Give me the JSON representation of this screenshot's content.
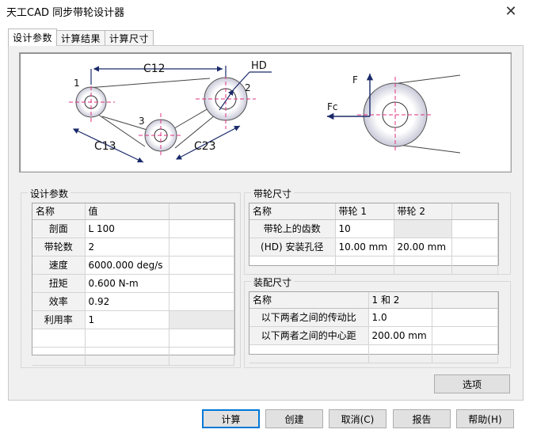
{
  "window": {
    "title": "天工CAD 同步带轮设计器"
  },
  "tabs": [
    {
      "label": "设计参数"
    },
    {
      "label": "计算结果"
    },
    {
      "label": "计算尺寸"
    }
  ],
  "diagram": {
    "labels": {
      "c12": "C12",
      "c13": "C13",
      "c23": "C23",
      "hd": "HD",
      "p1": "1",
      "p2": "2",
      "p3": "3",
      "f": "F",
      "fc": "Fc"
    }
  },
  "design": {
    "title": "设计参数",
    "headers": {
      "name": "名称",
      "value": "值"
    },
    "rows": [
      {
        "name": "剖面",
        "value": "L 100"
      },
      {
        "name": "带轮数",
        "value": "2"
      },
      {
        "name": "速度",
        "value": "6000.000 deg/s"
      },
      {
        "name": "扭矩",
        "value": "0.600 N-m"
      },
      {
        "name": "效率",
        "value": "0.92"
      },
      {
        "name": "利用率",
        "value": "1"
      }
    ]
  },
  "pulley": {
    "title": "带轮尺寸",
    "headers": {
      "name": "名称",
      "p1": "带轮 1",
      "p2": "带轮 2"
    },
    "rows": [
      {
        "name": "带轮上的齿数",
        "p1": "10",
        "p2": ""
      },
      {
        "name": "(HD) 安装孔径",
        "p1": "10.00 mm",
        "p2": "20.00 mm"
      }
    ]
  },
  "assembly": {
    "title": "装配尺寸",
    "headers": {
      "name": "名称",
      "pair": "1 和 2"
    },
    "rows": [
      {
        "name": "以下两者之间的传动比",
        "value": "1.0"
      },
      {
        "name": "以下两者之间的中心距",
        "value": "200.00 mm"
      }
    ]
  },
  "buttons": {
    "options": "选项",
    "calculate": "计算",
    "create": "创建",
    "cancel": "取消(C)",
    "report": "报告",
    "help": "帮助(H)"
  }
}
